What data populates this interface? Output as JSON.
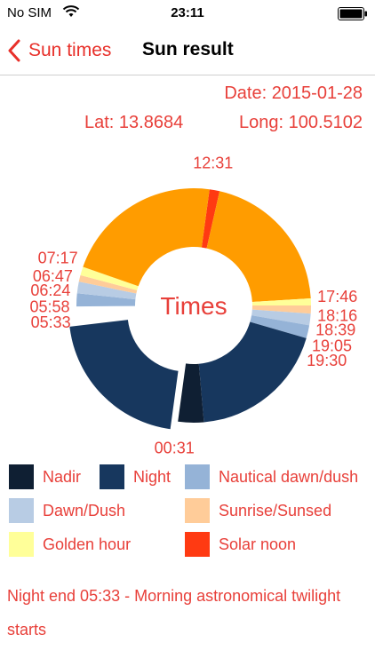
{
  "status_bar": {
    "carrier": "No SIM",
    "time": "23:11"
  },
  "nav": {
    "back_label": "Sun times",
    "title": "Sun result"
  },
  "info": {
    "date": "Date: 2015-01-28",
    "lat": "Lat: 13.8684",
    "long": "Long: 100.5102"
  },
  "chart_data": {
    "type": "pie",
    "center_label": "Times",
    "slices": [
      {
        "name": "Solar noon",
        "start": "12:31",
        "end": "12:51",
        "color": "#ff3a12"
      },
      {
        "name": "Golden hour",
        "start": "12:51",
        "end": "17:46",
        "color": "#ff9c00"
      },
      {
        "name": "Golden hour",
        "start": "17:46",
        "end": "18:00",
        "color": "#ffff99"
      },
      {
        "name": "Sunrise/Sunsed",
        "start": "18:00",
        "end": "18:16",
        "color": "#ffcc99"
      },
      {
        "name": "Dawn/Dush",
        "start": "18:16",
        "end": "18:39",
        "color": "#b8cce4"
      },
      {
        "name": "Nautical dawn/dush",
        "start": "18:39",
        "end": "19:05",
        "color": "#95b3d7"
      },
      {
        "name": "Night",
        "start": "19:05",
        "end": "23:40",
        "color": "#17375e"
      },
      {
        "name": "Nadir",
        "start": "23:40",
        "end": "00:31",
        "color": "#0f1f33"
      },
      {
        "name": "Night",
        "start": "00:31",
        "end": "05:33",
        "color": "#17375e",
        "exploded": true
      },
      {
        "name": "Nautical dawn/dush",
        "start": "05:58",
        "end": "06:24",
        "color": "#95b3d7"
      },
      {
        "name": "Dawn/Dush",
        "start": "06:24",
        "end": "06:47",
        "color": "#b8cce4"
      },
      {
        "name": "Sunrise/Sunsed",
        "start": "06:47",
        "end": "07:00",
        "color": "#ffcc99"
      },
      {
        "name": "Golden hour",
        "start": "07:00",
        "end": "07:17",
        "color": "#ffff99"
      },
      {
        "name": "Golden hour",
        "start": "07:17",
        "end": "12:31",
        "color": "#ff9c00"
      }
    ],
    "time_labels": [
      "12:31",
      "17:46",
      "18:16",
      "18:39",
      "19:05",
      "19:30",
      "00:31",
      "05:33",
      "05:58",
      "06:24",
      "06:47",
      "07:17"
    ]
  },
  "legend": [
    {
      "label": "Nadir",
      "color": "#0f1f33"
    },
    {
      "label": "Night",
      "color": "#17375e"
    },
    {
      "label": "Nautical dawn/dush",
      "color": "#95b3d7"
    },
    {
      "label": "Dawn/Dush",
      "color": "#b8cce4"
    },
    {
      "label": "Sunrise/Sunsed",
      "color": "#ffcc99"
    },
    {
      "label": "Golden hour",
      "color": "#ffff99"
    },
    {
      "label": "Solar noon",
      "color": "#ff3a12"
    }
  ],
  "footer": {
    "text": "Night end 05:33 - Morning astronomical twilight starts"
  },
  "colors": {
    "accent": "#e8302a",
    "text_red": "#e8403a"
  }
}
